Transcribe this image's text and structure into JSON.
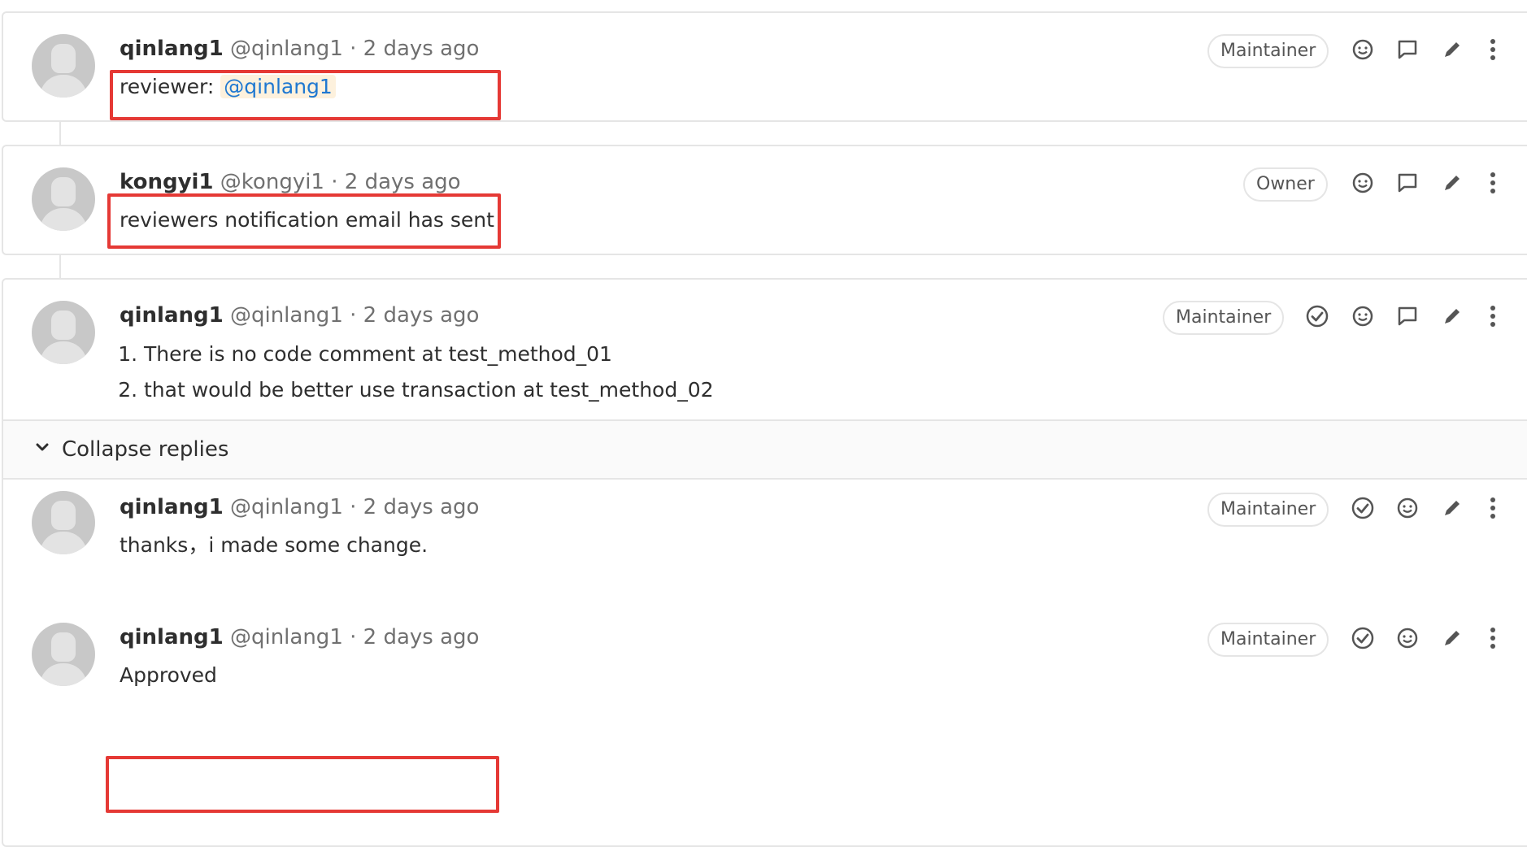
{
  "notes": [
    {
      "author": "qinlang1",
      "handle": "@qinlang1 · 2 days ago",
      "role": "Maintainer",
      "body_prefix": "reviewer:",
      "mention": "@qinlang1"
    },
    {
      "author": "kongyi1",
      "handle": "@kongyi1 · 2 days ago",
      "role": "Owner",
      "body": "reviewers notification email has sent"
    },
    {
      "author": "qinlang1",
      "handle": "@qinlang1 · 2 days ago",
      "role": "Maintainer",
      "list": [
        "There is no code comment at test_method_01",
        "that would be better use transaction at test_method_02"
      ]
    }
  ],
  "collapse_label": "Collapse replies",
  "replies": [
    {
      "author": "qinlang1",
      "handle": "@qinlang1 · 2 days ago",
      "role": "Maintainer",
      "body": "thanks，i made some change."
    },
    {
      "author": "qinlang1",
      "handle": "@qinlang1 · 2 days ago",
      "role": "Maintainer",
      "body": "Approved"
    }
  ],
  "colors": {
    "highlight": "#e53935",
    "mention_bg": "#fdf1dd",
    "link": "#1f78d1"
  },
  "icons": [
    "resolve-icon",
    "smiley-icon",
    "comment-icon",
    "pencil-icon",
    "more-vertical-icon"
  ]
}
